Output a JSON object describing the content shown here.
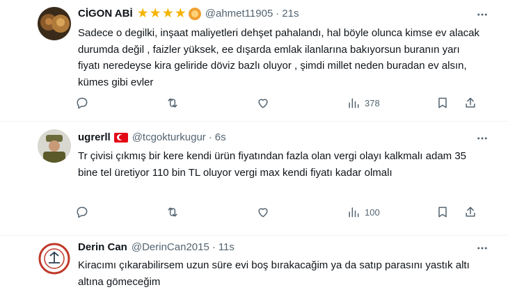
{
  "tweets": [
    {
      "name": "CİGON ABİ",
      "stars": "★★★★",
      "handle": "@ahmet11905",
      "dot": "·",
      "time": "21s",
      "text": "Sadece o degilki, inşaat maliyetleri dehşet pahalandı, hal böyle olunca kimse ev alacak durumda değil , faizler yüksek, ee dışarda emlak ilanlarına bakıyorsun buranın yarı fiyatı neredeyse kira geliride döviz bazlı oluyor , şimdi millet neden buradan ev alsın, kümes gibi evler",
      "views": "378"
    },
    {
      "name": "ugrerll",
      "handle": "@tcgokturkugur",
      "dot": "·",
      "time": "6s",
      "text": "Tr çivisi çıkmış bir kere kendi ürün fiyatından fazla olan vergi olayı kalkmalı adam 35 bine tel üretiyor 110 bin TL oluyor vergi max kendi fiyatı kadar olmalı",
      "views": "100"
    },
    {
      "name": "Derin Can",
      "handle": "@DerinCan2015",
      "dot": "·",
      "time": "11s",
      "text": "Kiracımı çıkarabilirsem uzun süre evi boş bırakacağim ya da satıp parasını yastık altı altına gömeceğim"
    }
  ],
  "colors": {
    "text": "#0f1419",
    "secondary": "#536471",
    "divider": "#eff3f4",
    "star": "#f5b400"
  }
}
